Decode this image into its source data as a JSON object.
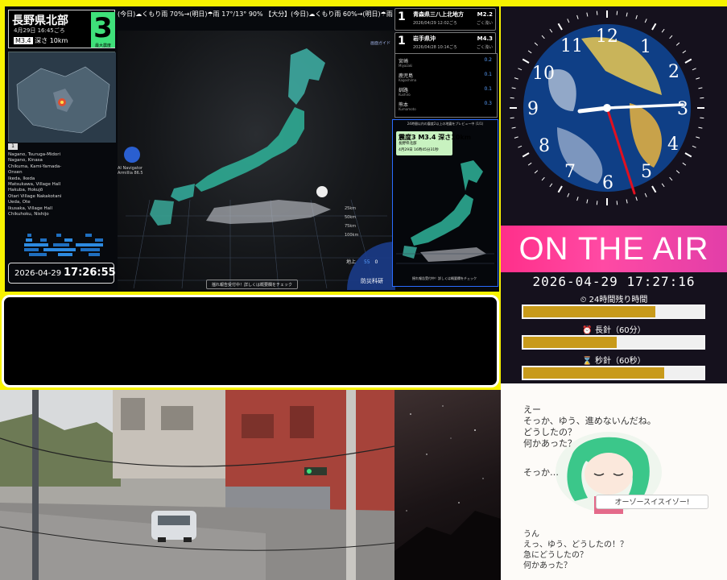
{
  "quake": {
    "epicenter": "長野県北部",
    "datetime": "4月29日 16:45ごろ",
    "magnitude": "M3.4",
    "depth": "深さ 10km",
    "intensity": "3",
    "intensity_label": "最大震度",
    "ticker": "(今日)☁くもり雨 70%→(明日)☂雨 17°/13° 90% 【大分】(今日)☁くもり雨 60%→(明日)☂雨 15°/12° 80%",
    "station_badge": "1",
    "stations": [
      "Nagano, Tsuruga-Midori",
      "Nagano, Kinasa",
      "Chikuma, Kami-Yamada-",
      "Onsen",
      "Ikeda, Ikeda",
      "Matsukawa, Village Hall",
      "Hakuba, Hokujō",
      "Otari Village Nakakotani",
      "Ueda, Ote",
      "Ikusaka, Village Hall",
      "Chikuhoku, Nishijo"
    ],
    "clock": {
      "date": "2026-04-29",
      "time": "17:26:55"
    },
    "nav_label": "AI Navigator\nArmillia 86.5",
    "guide_label": "画面ガイド",
    "depth_labels": [
      "25km",
      "50km",
      "75km",
      "100km"
    ],
    "count_labels": [
      "地上",
      "55",
      "0"
    ],
    "notice": "揺れ報告受付中！詳しくは概要欄をチェック",
    "logo": "防災科研",
    "list": [
      {
        "num": "1",
        "place": "青森県三八上北地方",
        "time": "2026/04/29 12:02ごろ",
        "mag": "M2.2",
        "note": "ごく浅い"
      },
      {
        "num": "1",
        "place": "岩手県沖",
        "time": "2026/04/28 10:14ごろ",
        "mag": "M4.3",
        "note": "ごく浅い"
      }
    ],
    "observations": [
      {
        "region": "宮崎",
        "en": "Miyazaki",
        "value": "0.2"
      },
      {
        "region": "鹿児島",
        "en": "Kagoshima",
        "value": "0.1"
      },
      {
        "region": "釧路",
        "en": "Kushiro",
        "value": "0.1"
      },
      {
        "region": "熊本",
        "en": "Kumamoto",
        "value": "0.3"
      }
    ],
    "preview": {
      "header": "24時間以内の震度2以上の地震をプレビュー中 (1/1)",
      "title": "震度3 M3.4 深さ10km",
      "place": "長野県北部",
      "time": "4月29日 16時45分31秒",
      "footer": "揺れ報告受付中！詳しくは概要欄をチェック"
    }
  },
  "onair": {
    "title": "ON THE AIR",
    "datetime": "2026-04-29 17:27:16",
    "bars": [
      {
        "label": "⏲ 24時間残り時間",
        "fill": 0.73
      },
      {
        "label": "⏰ 長針（60分）",
        "fill": 0.52
      },
      {
        "label": "⌛ 秒針（60秒）",
        "fill": 0.78
      }
    ]
  },
  "chat": {
    "lines": [
      "えー",
      "そっか、ゆう、進めないんだね。",
      "どうしたの？",
      "何かあった？",
      "そっか…",
      "うん",
      "えっ、ゆう、どうしたの！？",
      "急にどうしたの？",
      "何かあった？"
    ],
    "speech": "オーゾースイスイゾー!"
  },
  "colors": {
    "accent": "#3fe07a",
    "onair": "#ff3a96",
    "bar_fill": "#c89a1a",
    "frame": "#f7f200"
  }
}
